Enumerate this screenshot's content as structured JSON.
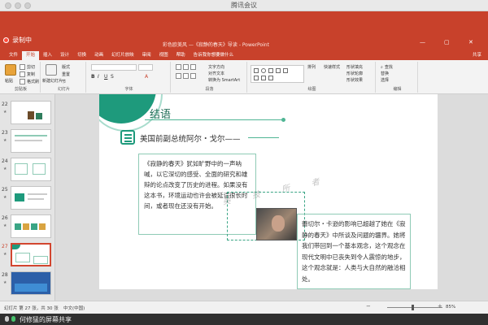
{
  "window": {
    "title": "腾讯会议"
  },
  "recording": {
    "label": "录制中"
  },
  "ppt": {
    "doc_title": "彩色欧美风 —《寂静的春天》导读 - PowerPoint",
    "tabs": [
      "文件",
      "开始",
      "插入",
      "设计",
      "切换",
      "动画",
      "幻灯片放映",
      "审阅",
      "视图",
      "帮助",
      "告诉我你想要做什么"
    ],
    "active_tab": "开始",
    "share_label": "共享",
    "ribbon_groups": [
      "剪贴板",
      "幻灯片",
      "字体",
      "段落",
      "绘图",
      "编辑"
    ],
    "ribbon_buttons": {
      "paste": "粘贴",
      "cut": "剪切",
      "copy": "复制",
      "format_painter": "格式刷",
      "new_slide": "新建幻灯片",
      "layout": "版式",
      "reset": "重置",
      "section": "节",
      "arrange": "排列",
      "quick_styles": "快速样式",
      "shape_fill": "形状填充",
      "shape_outline": "形状轮廓",
      "shape_effects": "形状效果",
      "find": "查找",
      "replace": "替换",
      "select": "选择",
      "text_direction": "文字方向",
      "align_text": "对齐文本",
      "smartart": "转换为 SmartArt"
    }
  },
  "thumbnails": [
    {
      "num": "22",
      "star": "★"
    },
    {
      "num": "23",
      "star": "★"
    },
    {
      "num": "24",
      "star": "★"
    },
    {
      "num": "25",
      "star": "★"
    },
    {
      "num": "26",
      "star": "★"
    },
    {
      "num": "27",
      "star": "★"
    },
    {
      "num": "28",
      "star": "★"
    }
  ],
  "slide": {
    "title": "结语",
    "subtitle": "美国前副总统阿尔・戈尔——",
    "paragraph1": "《寂静的春天》犹如旷野中的一声呐喊，以它深切的感受、全面的研究和雄辩的论点改变了历史的进程。如果没有这本书，环境运动也许会被延误很长时间，或者现在还没有开始。",
    "paragraph2": "蕾切尔・卡逊的影响已超越了她在《寂静的春天》中所谈及问题的疆界。她将我们带回到一个基本观念，这个观念在现代文明中已丧失到令人震惊的地步，这个观念就是：人类与大自然的融洽相处。",
    "watermark": "美 技 所 者"
  },
  "status": {
    "slide_info": "幻灯片 第 27 张，共 30 张",
    "language": "中文(中国)",
    "zoom": "85%"
  },
  "share_bar": {
    "text": "何修猛的屏幕共享"
  },
  "colors": {
    "accent": "#c8412b",
    "teal": "#1e9a7c"
  }
}
